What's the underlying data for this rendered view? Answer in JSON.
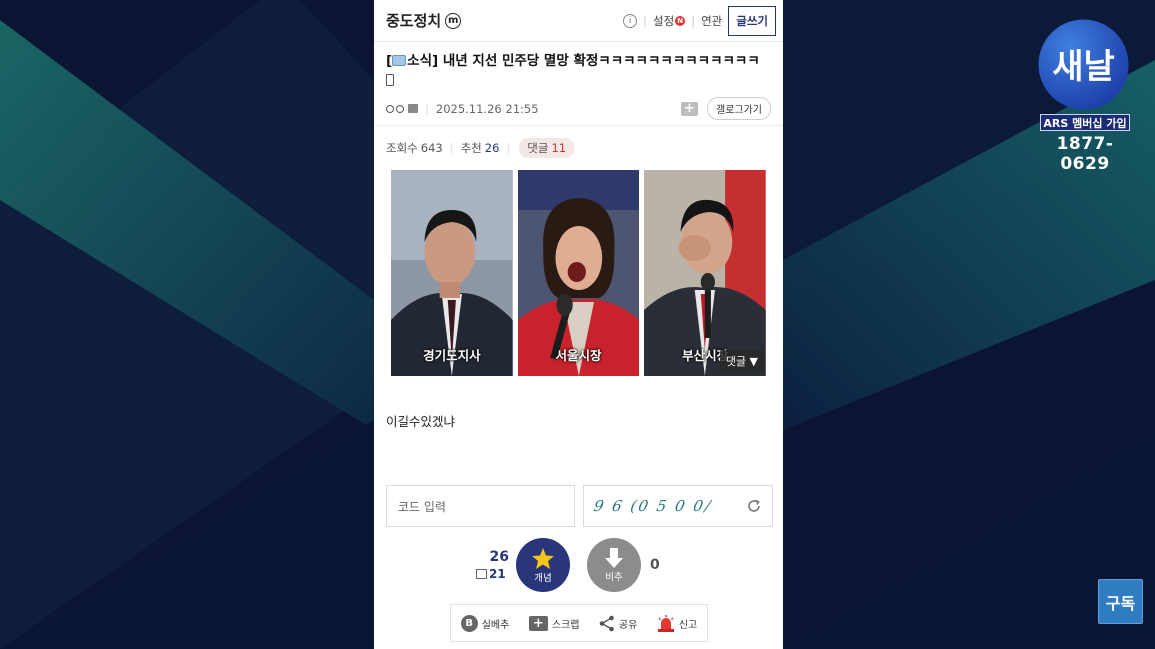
{
  "gallery": {
    "name": "중도정치",
    "badge": "m"
  },
  "topbar": {
    "settings_label": "설정",
    "settings_badge": "N",
    "related_label": "연관",
    "write_label": "글쓰기"
  },
  "post": {
    "title": "소식] 내년 지선 민주당 멸망 확정ㅋㅋㅋㅋㅋㅋㅋㅋㅋㅋㅋㅋㅋ",
    "title_prefix": "[",
    "datetime": "2025.11.26 21:55",
    "gallery_go_label": "갤로그가기",
    "views_label": "조회수",
    "views": "643",
    "recommend_label": "추천",
    "recommend": "26",
    "comments_label": "댓글",
    "comments": "11",
    "body": "이길수있겠냐"
  },
  "photos": [
    {
      "caption": "경기도지사"
    },
    {
      "caption": "서울시장"
    },
    {
      "caption": "부산시장"
    }
  ],
  "comment_overlay": "댓글 ▼",
  "captcha": {
    "placeholder": "코드 입력",
    "image_text": "9 6 (0 5 0 0/"
  },
  "vote": {
    "up_count": "26",
    "fix_count": "21",
    "up_label": "개념",
    "down_label": "비추",
    "down_count": "0"
  },
  "actions": [
    {
      "label": "실베추",
      "icon": "b-circle-icon"
    },
    {
      "label": "스크랩",
      "icon": "scrap-icon"
    },
    {
      "label": "공유",
      "icon": "share-icon"
    },
    {
      "label": "신고",
      "icon": "siren-icon"
    }
  ],
  "channel": {
    "logo_text": "새날",
    "membership": "ARS 멤버십 가입",
    "phone": "1877-0629",
    "subscribe": "구독"
  },
  "colors": {
    "accent": "#29367c",
    "background": "#0b1433",
    "comment_red": "#c0392b"
  }
}
